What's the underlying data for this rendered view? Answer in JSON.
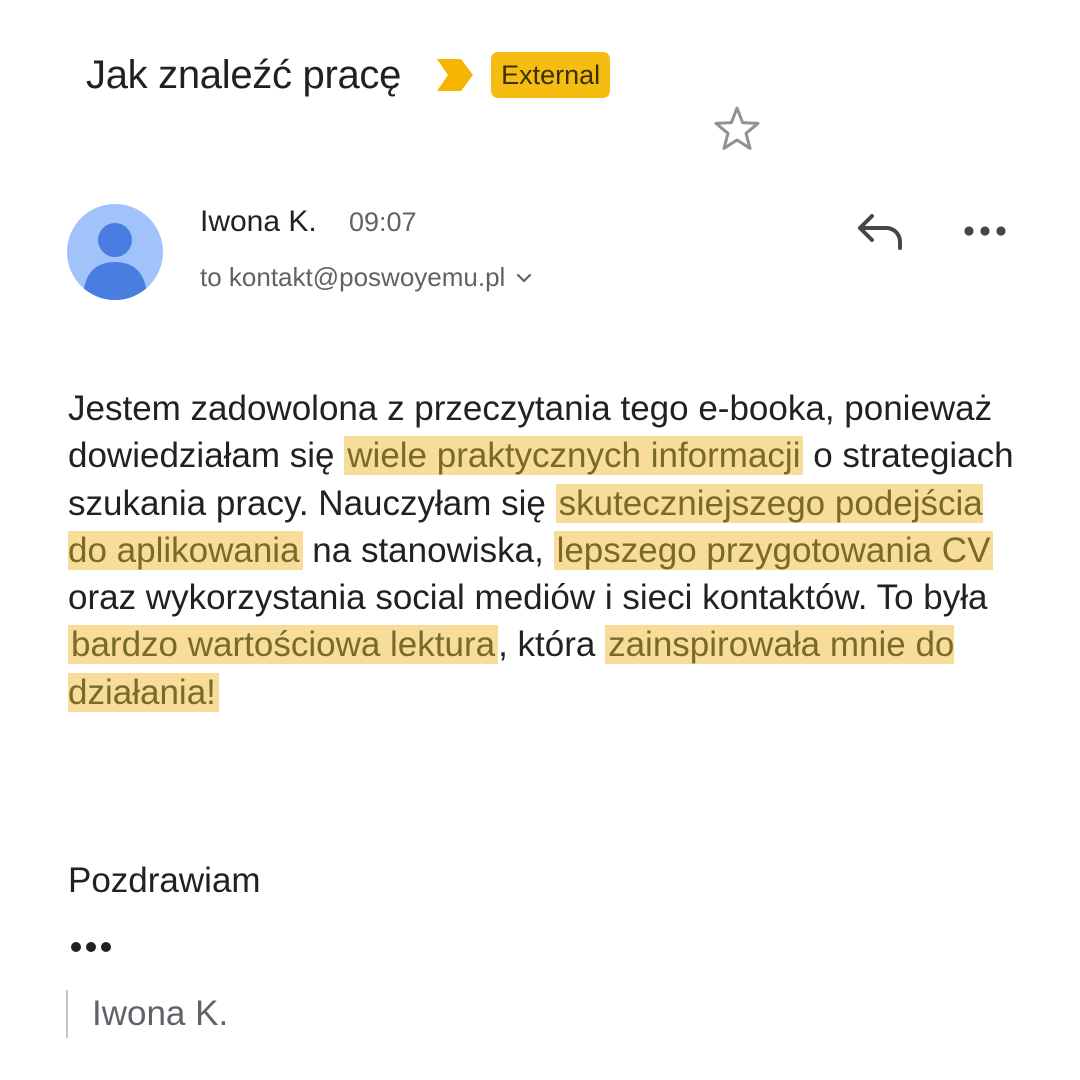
{
  "email": {
    "subject": "Jak znaleźć pracę",
    "label": "External",
    "sender_name": "Iwona K.",
    "time": "09:07",
    "recipient": "to kontakt@poswoyemu.pl",
    "body": {
      "p1": "Jestem zadowolona z przeczytania tego e-booka, ponieważ dowiedziałam się",
      "h1": "wiele praktycznych informacji",
      "p2": "o strategiach szukania pracy. Nauczyłam się",
      "h2": "skuteczniejszego podejścia do aplikowania",
      "p3": "na stanowiska,",
      "h3": "lepszego przygotowania CV",
      "p4": "oraz wykorzystania social mediów i sieci kontaktów. To była",
      "h4": "bardzo wartościowa lektura",
      "p5": ", która",
      "h5": "zainspirowała mnie do działania!"
    },
    "greeting": "Pozdrawiam",
    "signature": "Iwona K."
  },
  "icons": {
    "importance": "importance-marker-icon",
    "star": "star-outline-icon",
    "avatar": "person-avatar-icon",
    "chevron": "chevron-down-icon",
    "reply": "reply-icon",
    "more": "more-horizontal-icon",
    "trimmed": "show-trimmed-content-icon"
  },
  "colors": {
    "label_bg": "#f5bc12",
    "highlight_bg": "#f7dd99",
    "highlight_text": "#7a6a28",
    "avatar_bg": "#a1c2fa",
    "avatar_fg": "#4a7de0"
  }
}
